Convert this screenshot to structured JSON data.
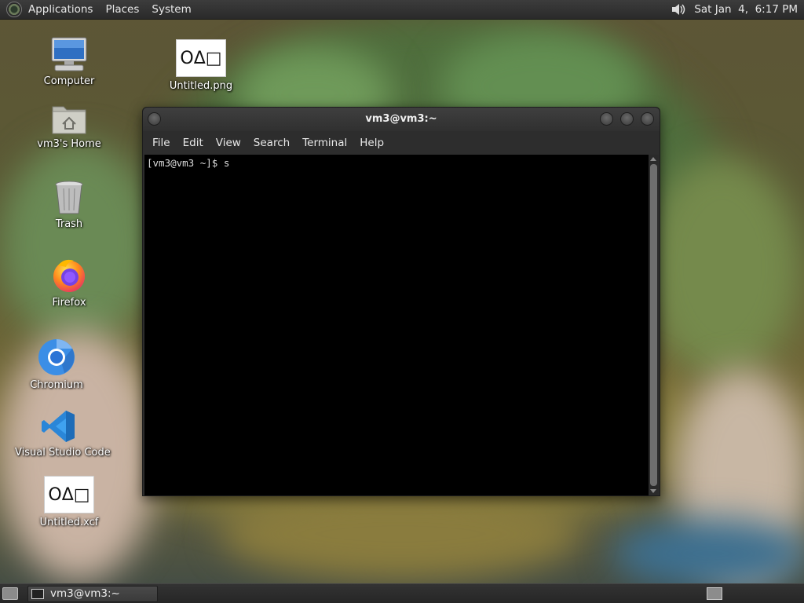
{
  "top_panel": {
    "menus": [
      "Applications",
      "Places",
      "System"
    ],
    "clock": "Sat Jan  4,  6:17 PM"
  },
  "desktop": {
    "icons": [
      {
        "label": "Computer",
        "icon": "computer-icon"
      },
      {
        "label": "vm3's Home",
        "icon": "home-folder-icon"
      },
      {
        "label": "Trash",
        "icon": "trash-icon"
      },
      {
        "label": "Firefox",
        "icon": "firefox-icon"
      },
      {
        "label": "Chromium",
        "icon": "chromium-icon"
      },
      {
        "label": "Visual Studio Code",
        "icon": "vscode-icon"
      },
      {
        "label": "Untitled.xcf",
        "icon": "image-file-icon"
      },
      {
        "label": "Untitled.png",
        "icon": "image-file-icon"
      }
    ],
    "file_thumbnail_text": "OΔ□"
  },
  "terminal": {
    "title": "vm3@vm3:~",
    "menu": [
      "File",
      "Edit",
      "View",
      "Search",
      "Terminal",
      "Help"
    ],
    "content": "[vm3@vm3 ~]$ s"
  },
  "bottom_panel": {
    "task_label": "vm3@vm3:~"
  },
  "colors": {
    "panel_bg": "#2e2e2e",
    "terminal_bg": "#000000",
    "terminal_fg": "#dcdcdc",
    "vscode_blue": "#2a86d8",
    "chromium_blue": "#3b8ee6"
  }
}
